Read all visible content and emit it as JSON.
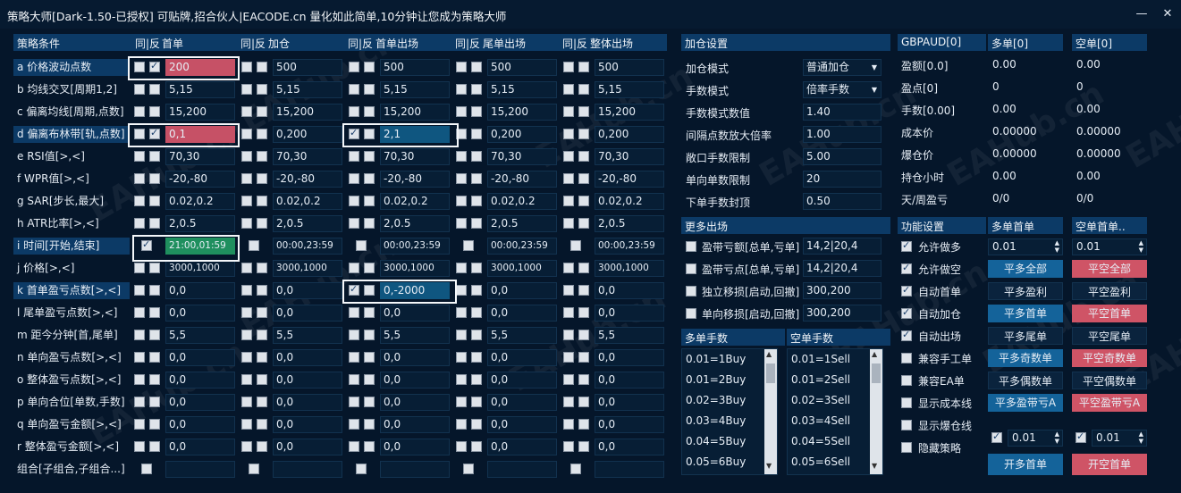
{
  "window": {
    "title": "策略大师[Dark-1.50-已授权]  可贴牌,招合伙人|EACODE.cn  量化如此简单,10分钟让您成为策略大师",
    "min_icon": "minimize-icon",
    "close_icon": "close-icon"
  },
  "left": {
    "headers": {
      "strategy": "策略条件",
      "same_rev": "同|反",
      "first": "首单",
      "add": "加仓",
      "first_exit": "首单出场",
      "tail_exit": "尾单出场",
      "overall_exit": "整体出场"
    },
    "rows": [
      {
        "label": "a 价格波动点数",
        "v": [
          "200",
          "500",
          "500",
          "500",
          "500"
        ]
      },
      {
        "label": "b 均线交叉[周期1,2]",
        "v": [
          "5,15",
          "5,15",
          "5,15",
          "5,15",
          "5,15"
        ]
      },
      {
        "label": "c 偏离均线[周期,点数]",
        "v": [
          "15,200",
          "15,200",
          "15,200",
          "15,200",
          "15,200"
        ]
      },
      {
        "label": "d 偏离布林带[轨,点数]",
        "v": [
          "0,1",
          "0,200",
          "2,1",
          "0,200",
          "0,200"
        ]
      },
      {
        "label": "e RSI值[>,<]",
        "v": [
          "70,30",
          "70,30",
          "70,30",
          "70,30",
          "70,30"
        ]
      },
      {
        "label": "f WPR值[>,<]",
        "v": [
          "-20,-80",
          "-20,-80",
          "-20,-80",
          "-20,-80",
          "-20,-80"
        ]
      },
      {
        "label": "g SAR[步长,最大]",
        "v": [
          "0.02,0.2",
          "0.02,0.2",
          "0.02,0.2",
          "0.02,0.2",
          "0.02,0.2"
        ]
      },
      {
        "label": "h ATR比率[>,<]",
        "v": [
          "2,0.5",
          "2,0.5",
          "2,0.5",
          "2,0.5",
          "2,0.5"
        ]
      },
      {
        "label": "i 时间[开始,结束]",
        "v": [
          "21:00,01:59",
          "00:00,23:59",
          "00:00,23:59",
          "00:00,23:59",
          "00:00,23:59"
        ]
      },
      {
        "label": "j 价格[>,<]",
        "v": [
          "3000,1000",
          "3000,1000",
          "3000,1000",
          "3000,1000",
          "3000,1000"
        ]
      },
      {
        "label": "k 首单盈亏点数[>,<]",
        "v": [
          "0,0",
          "0,0",
          "0,-2000",
          "0,0",
          "0,0"
        ]
      },
      {
        "label": "l 尾单盈亏点数[>,<]",
        "v": [
          "0,0",
          "0,0",
          "0,0",
          "0,0",
          "0,0"
        ]
      },
      {
        "label": "m 距今分钟[首,尾单]",
        "v": [
          "5,5",
          "5,5",
          "5,5",
          "5,5",
          "5,5"
        ]
      },
      {
        "label": "n 单向盈亏点数[>,<]",
        "v": [
          "0,0",
          "0,0",
          "0,0",
          "0,0",
          "0,0"
        ]
      },
      {
        "label": "o 整体盈亏点数[>,<]",
        "v": [
          "0,0",
          "0,0",
          "0,0",
          "0,0",
          "0,0"
        ]
      },
      {
        "label": "p 单向合位[单数,手数]",
        "v": [
          "0,0",
          "0,0",
          "0,0",
          "0,0",
          "0,0"
        ]
      },
      {
        "label": "q 单向盈亏金额[>,<]",
        "v": [
          "0,0",
          "0,0",
          "0,0",
          "0,0",
          "0,0"
        ]
      },
      {
        "label": "r 整体盈亏金额[>,<]",
        "v": [
          "0,0",
          "0,0",
          "0,0",
          "0,0",
          "0,0"
        ]
      },
      {
        "label": "组合[子组合,子组合...]",
        "v": [
          "",
          "",
          "",
          "",
          ""
        ]
      }
    ]
  },
  "mid": {
    "add_header": "加仓设置",
    "settings": [
      {
        "label": "加仓模式",
        "value": "普通加仓",
        "type": "select"
      },
      {
        "label": "手数模式",
        "value": "倍率手数",
        "type": "select"
      },
      {
        "label": "手数模式数值",
        "value": "1.40",
        "type": "input"
      },
      {
        "label": "间隔点数放大倍率",
        "value": "1.00",
        "type": "input"
      },
      {
        "label": "敞口手数限制",
        "value": "5.00",
        "type": "input"
      },
      {
        "label": "单向单数限制",
        "value": "20",
        "type": "input"
      },
      {
        "label": "下单手数封顶",
        "value": "0.50",
        "type": "input"
      }
    ],
    "more_header": "更多出场",
    "more": [
      {
        "label": "盈带亏额[总单,亏单]",
        "value": "14,2|20,4"
      },
      {
        "label": "盈带亏点[总单,亏单]",
        "value": "14,2|20,4"
      },
      {
        "label": "独立移损[启动,回撤]",
        "value": "300,200"
      },
      {
        "label": "单向移损[启动,回撤]",
        "value": "300,200"
      }
    ],
    "buy_lots_header": "多单手数",
    "sell_lots_header": "空单手数",
    "buy_lots": [
      "0.01=1Buy",
      "0.01=2Buy",
      "0.02=3Buy",
      "0.03=4Buy",
      "0.04=5Buy",
      "0.05=6Buy"
    ],
    "sell_lots": [
      "0.01=1Sell",
      "0.01=2Sell",
      "0.02=3Sell",
      "0.03=4Sell",
      "0.04=5Sell",
      "0.05=6Sell"
    ]
  },
  "right": {
    "symbol": "GBPAUD[0]",
    "buy_head": "多单[0]",
    "sell_head": "空单[0]",
    "stats": [
      {
        "label": "盈额[0.0]",
        "buy": "0.00",
        "sell": "0.00"
      },
      {
        "label": "盈点[0]",
        "buy": "0",
        "sell": "0"
      },
      {
        "label": "手数[0.00]",
        "buy": "0.00",
        "sell": "0.00"
      },
      {
        "label": "成本价",
        "buy": "0.00000",
        "sell": "0.00000"
      },
      {
        "label": "爆仓价",
        "buy": "0.00000",
        "sell": "0.00000"
      },
      {
        "label": "持仓小时",
        "buy": "0.00",
        "sell": "0.00"
      },
      {
        "label": "天/周盈亏",
        "buy": "0/0",
        "sell": "0/0"
      }
    ],
    "func_header": "功能设置",
    "buy_first_header": "多单首单",
    "sell_first_header": "空单首单..",
    "funcs": [
      {
        "label": "允许做多",
        "on": true
      },
      {
        "label": "允许做空",
        "on": true
      },
      {
        "label": "自动首单",
        "on": true
      },
      {
        "label": "自动加仓",
        "on": true
      },
      {
        "label": "自动出场",
        "on": true
      },
      {
        "label": "兼容手工单",
        "on": false
      },
      {
        "label": "兼容EA单",
        "on": false
      },
      {
        "label": "显示成本线",
        "on": false
      },
      {
        "label": "显示爆仓线",
        "on": false
      },
      {
        "label": "隐藏策略",
        "on": false
      }
    ],
    "buy_lot": "0.01",
    "sell_lot": "0.01",
    "buttons": [
      {
        "buy": "平多全部",
        "sell": "平空全部",
        "style": "bs"
      },
      {
        "buy": "平多盈利",
        "sell": "平空盈利",
        "style": "dd"
      },
      {
        "buy": "平多首单",
        "sell": "平空首单",
        "style": "bs"
      },
      {
        "buy": "平多尾单",
        "sell": "平空尾单",
        "style": "dd"
      },
      {
        "buy": "平多奇数单",
        "sell": "平空奇数单",
        "style": "bs"
      },
      {
        "buy": "平多偶数单",
        "sell": "平空偶数单",
        "style": "dd"
      },
      {
        "buy": "平多盈带亏A",
        "sell": "平空盈带亏A",
        "style": "bs"
      }
    ],
    "buy_small": "0.01",
    "sell_small": "0.01",
    "open_buy": "开多首单",
    "open_sell": "开空首单"
  },
  "watermark": "EAHub.cn",
  "colors": {
    "bg": "#05162a",
    "header": "#0c3a66",
    "red": "#c65166",
    "blue": "#0f5680",
    "green": "#1f8f5e"
  }
}
